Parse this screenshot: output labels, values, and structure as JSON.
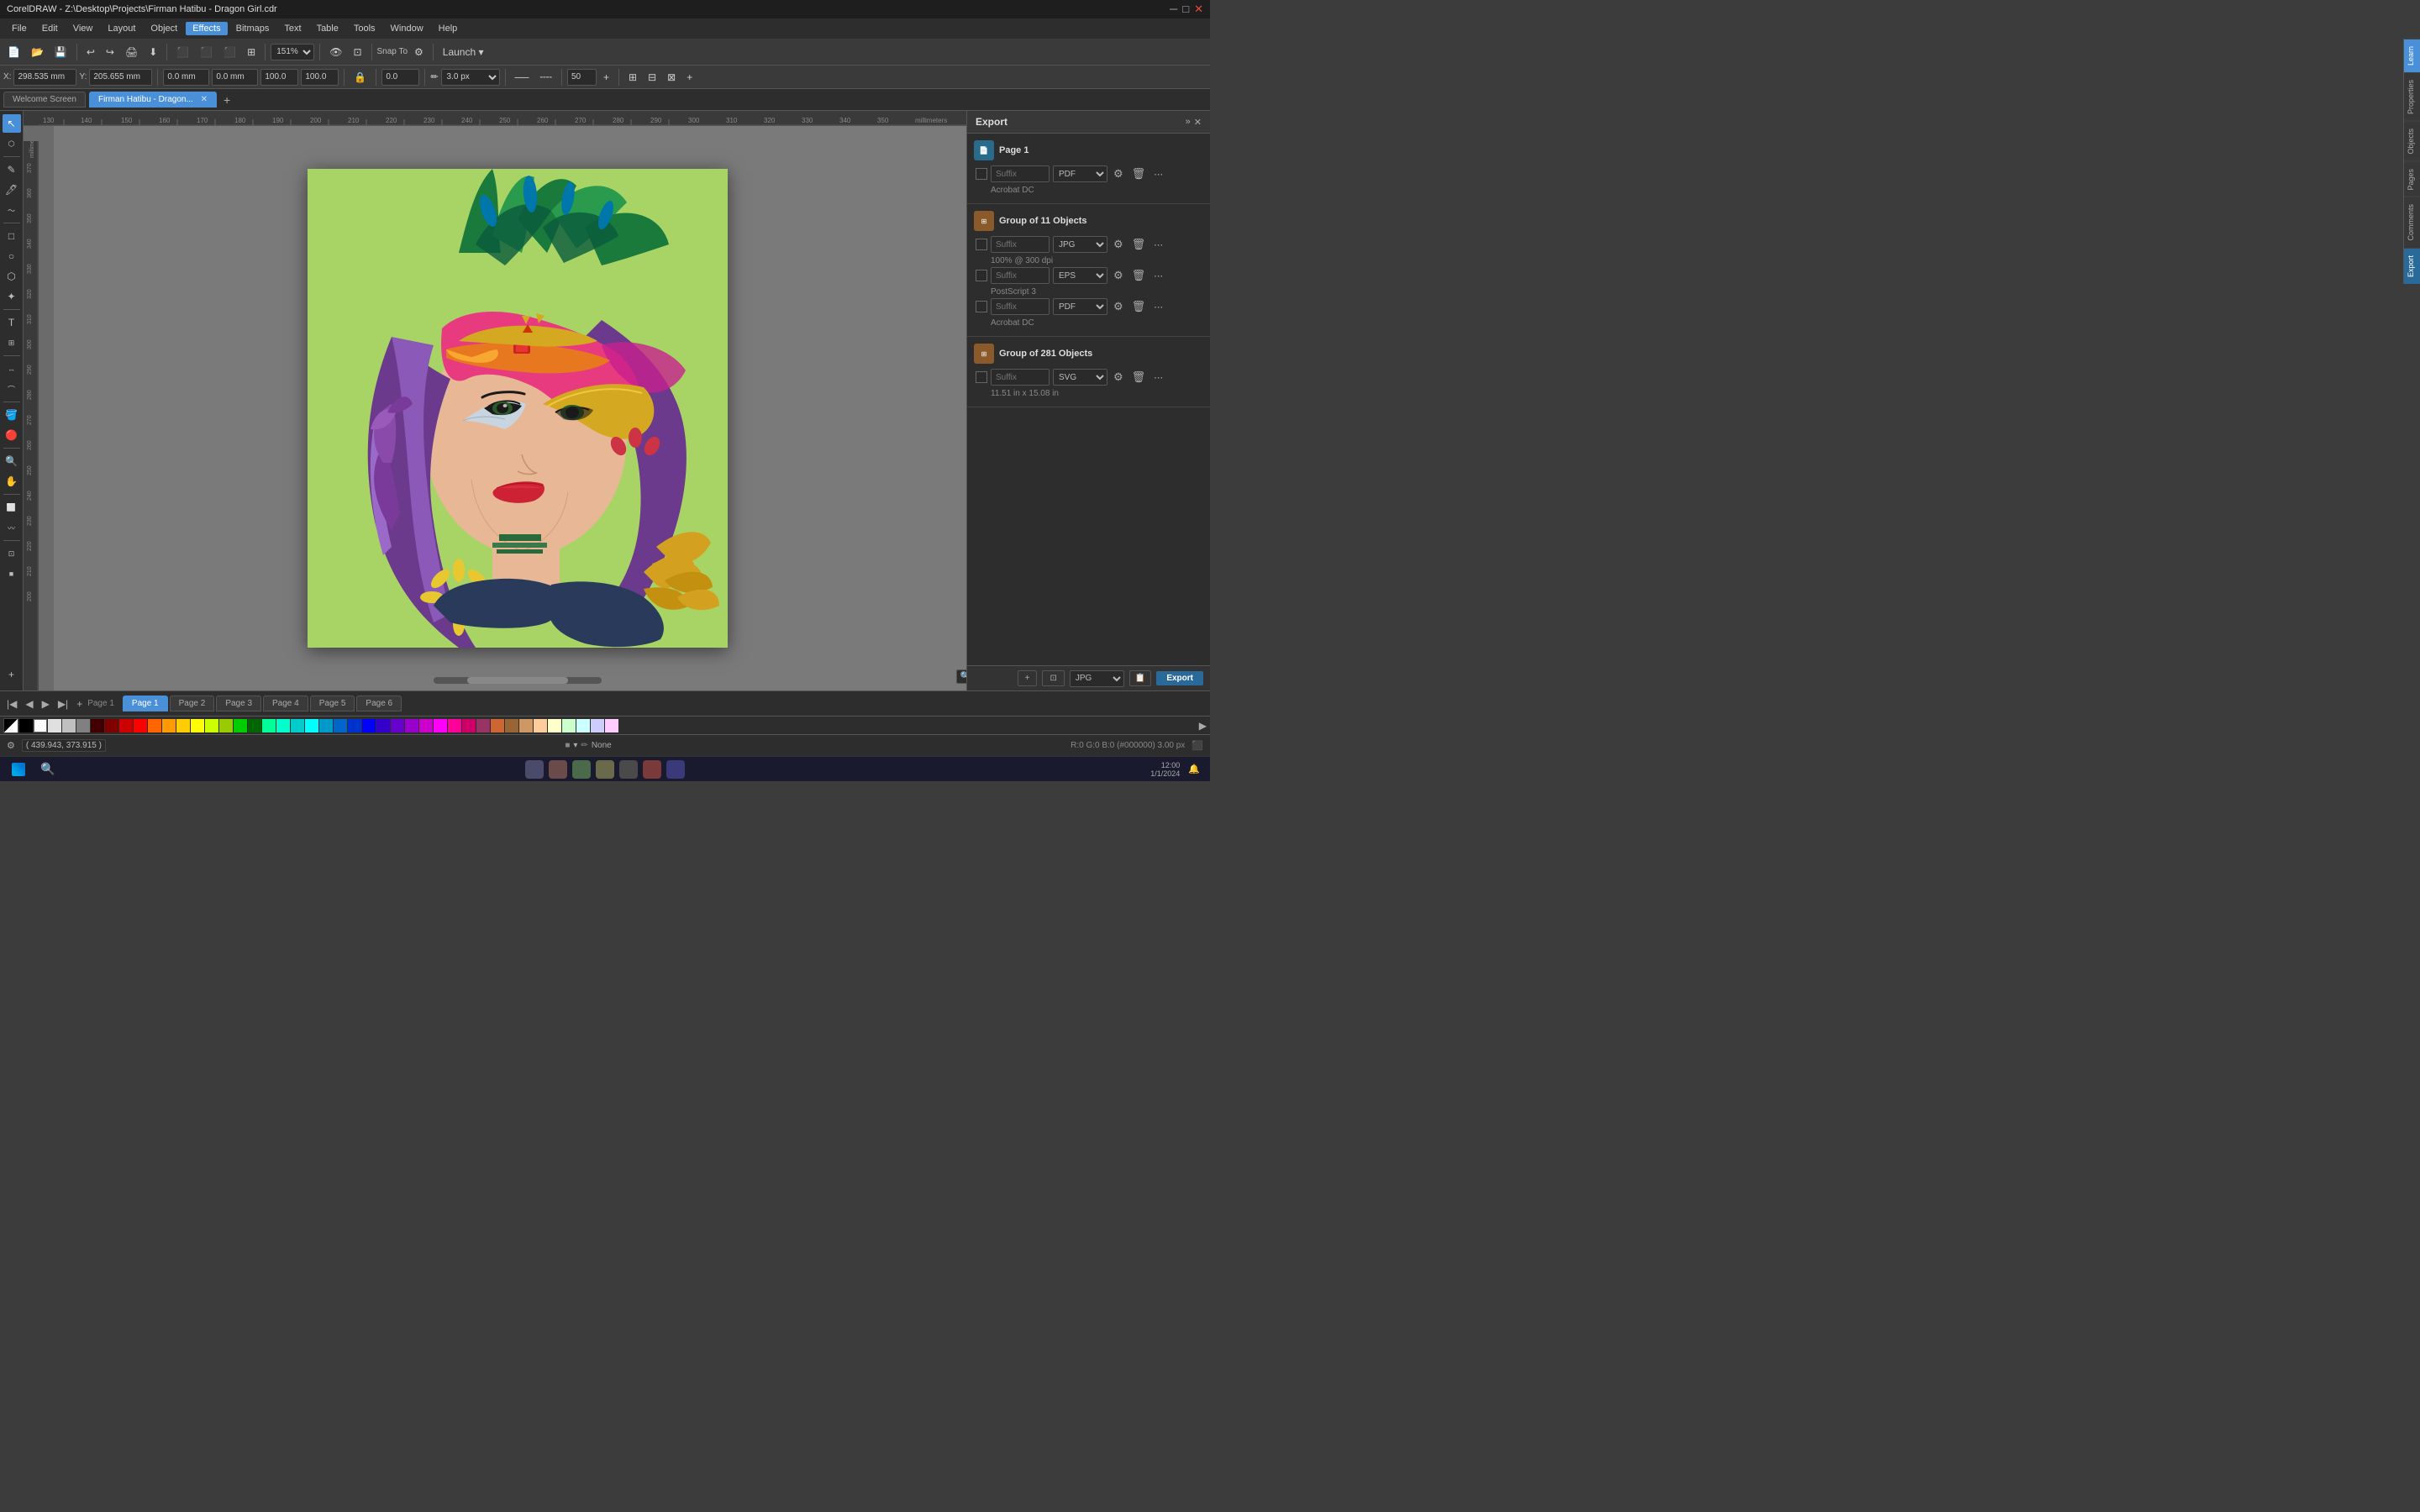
{
  "titlebar": {
    "title": "CorelDRAW - Z:\\Desktop\\Projects\\Firman Hatibu - Dragon Girl.cdr",
    "minimize": "─",
    "maximize": "□",
    "close": "✕"
  },
  "menubar": {
    "items": [
      "File",
      "Edit",
      "View",
      "Layout",
      "Object",
      "Effects",
      "Bitmaps",
      "Text",
      "Table",
      "Tools",
      "Window",
      "Help"
    ]
  },
  "toolbar1": {
    "new_label": "New",
    "open_label": "Open",
    "save_label": "Save",
    "zoom_value": "151%",
    "snap_to_label": "Snap To",
    "launch_label": "Launch"
  },
  "toolbar2": {
    "x_label": "X:",
    "x_value": "298.535 mm",
    "y_label": "Y:",
    "y_value": "205.655 mm",
    "w_value": "0.0 mm",
    "h_value": "0.0 mm",
    "w2_value": "100.0",
    "h2_value": "100.0",
    "angle_value": "0.0",
    "stroke_size": "3.0 px",
    "miter_value": "50"
  },
  "tabs": {
    "welcome": "Welcome Screen",
    "document": "Firman Hatibu - Dragon..."
  },
  "export_panel": {
    "title": "Export",
    "page_label": "Page 1",
    "group1_label": "Group of 11 Objects",
    "group1_subtext": "100% @ 300 dpi",
    "group2_label": "Group of 281 Objects",
    "group2_subtext": "11.51 in x 15.08 in",
    "suffix_placeholder": "Suffix",
    "acrobat_dc": "Acrobat DC",
    "postscript3": "PostScript 3",
    "formats": [
      "PDF",
      "JPG",
      "EPS",
      "PDF",
      "SVG"
    ],
    "export_button": "Export",
    "jpg_format": "JPG"
  },
  "side_tabs": [
    "Learn",
    "Properties",
    "Objects",
    "Pages",
    "Comments",
    "Export"
  ],
  "pages": {
    "current": "1 of 6",
    "items": [
      "Page 1",
      "Page 2",
      "Page 3",
      "Page 4",
      "Page 5",
      "Page 6"
    ]
  },
  "statusbar": {
    "coords": "( 439.943, 373.915 )",
    "fill": "None",
    "stroke_info": "R:0 G:0 B:0 (#000000) 3.00 px"
  },
  "colors": {
    "swatches": [
      "#000000",
      "#FFFFFF",
      "#FF0000",
      "#FF6600",
      "#FFCC00",
      "#FFFF00",
      "#66FF00",
      "#00FF00",
      "#00FF99",
      "#00FFFF",
      "#0099FF",
      "#0000FF",
      "#6600FF",
      "#FF00FF",
      "#FF0099",
      "#CC3300",
      "#FF6633",
      "#FFCC33",
      "#CCFF00",
      "#33CC00",
      "#00CC99",
      "#3399FF",
      "#3333FF",
      "#9933FF",
      "#FF33CC",
      "#993300",
      "#CC6600",
      "#FFAA00",
      "#AACC00",
      "#009966",
      "#006699",
      "#003399",
      "#660099",
      "#990066",
      "#660000",
      "#993300",
      "#CC6633",
      "#FFCC99",
      "#99CC66",
      "#336633",
      "#336666",
      "#003366",
      "#330066",
      "#663366"
    ]
  }
}
